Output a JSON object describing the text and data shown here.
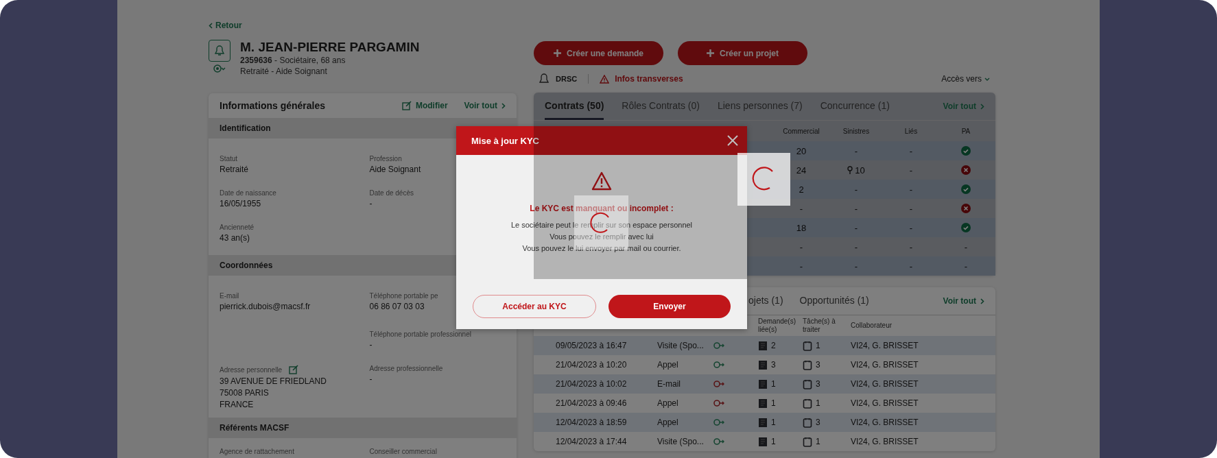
{
  "back_link": "Retour",
  "client": {
    "name": "M. JEAN-PIERRE PARGAMIN",
    "line1": "**2359636** - Sociétaire, 68 ans",
    "line2": "Retraité - Aide Soignant"
  },
  "actions": [
    "Créer une demande",
    "Créer un projet"
  ],
  "info_bar": {
    "entity": "DRSC",
    "alert": "Infos transverses",
    "access": "Accès vers"
  },
  "general_info": {
    "title": "Informations générales",
    "edit": "Modifier",
    "see_all": "Voir tout",
    "sections": [
      {
        "title": "Identification",
        "fields": [
          {
            "label": "Statut",
            "lines": [
              "Retraité"
            ]
          },
          {
            "label": "Profession",
            "lines": [
              "Aide Soignant"
            ]
          },
          {
            "label": "Date de naissance",
            "lines": [
              "16/05/1955"
            ]
          },
          {
            "label": "Date de décès",
            "lines": [
              "-"
            ]
          },
          {
            "label": "Ancienneté",
            "lines": [
              "43 an(s)"
            ]
          }
        ]
      },
      {
        "title": "Coordonnées",
        "fields": [
          {
            "label": "E-mail",
            "lines": [
              "pierrick.dubois@macsf.fr"
            ]
          },
          {
            "label": "Téléphone portable pe",
            "lines": [
              "06 86 07 03 03"
            ]
          },
          {
            "label": "Téléphone portable professionnel",
            "right_column": true,
            "lines": [
              "-"
            ]
          },
          {
            "label": "Adresse personnelle",
            "editable": true,
            "lines": [
              "39 AVENUE DE FRIEDLAND",
              "75008 PARIS",
              "FRANCE"
            ]
          },
          {
            "label": "Adresse professionnelle",
            "lines": [
              "-"
            ]
          }
        ]
      },
      {
        "title": "Référents MACSF",
        "fields": [
          {
            "label": "Agence de rattachement"
          },
          {
            "label": "Conseiller commercial"
          }
        ]
      }
    ]
  },
  "contracts": {
    "tabs": [
      {
        "label": "Contrats (50)",
        "selected": true
      },
      {
        "label": "Rôles Contrats (0)",
        "selected": false
      },
      {
        "label": "Liens personnes (7)",
        "selected": false
      },
      {
        "label": "Concurrence (1)",
        "selected": false
      }
    ],
    "see_all": "Voir tout",
    "loading": true,
    "columns": [
      "Commercial",
      "Sinistres",
      "Liés",
      "PA"
    ],
    "rows": [
      {
        "cells": [
          {
            "text": "20"
          },
          {
            "text": "-"
          },
          {
            "text": "-"
          }
        ],
        "pa": {
          "kind": "status",
          "valid": true
        }
      },
      {
        "cells": [
          {
            "text": "24"
          },
          {
            "text": "10",
            "kind": "with_icon"
          },
          {
            "text": "-"
          }
        ],
        "pa": {
          "kind": "status",
          "valid": false
        }
      },
      {
        "cells": [
          {
            "text": "2"
          },
          {
            "text": "-"
          },
          {
            "text": "-"
          }
        ],
        "pa": {
          "kind": "status",
          "valid": true
        }
      },
      {
        "cells": [
          {
            "text": "-"
          },
          {
            "text": "-"
          },
          {
            "text": "-"
          }
        ],
        "pa": {
          "kind": "status",
          "valid": false
        }
      },
      {
        "cells": [
          {
            "text": "18"
          },
          {
            "text": "-"
          },
          {
            "text": "-"
          }
        ],
        "pa": {
          "kind": "status",
          "valid": true
        }
      },
      {
        "cells": [
          {
            "text": "-"
          },
          {
            "text": "-"
          },
          {
            "text": "-"
          }
        ],
        "pa": {
          "kind": "text",
          "text": "-"
        }
      },
      {
        "cells": [
          {
            "text": "-"
          },
          {
            "text": "-"
          },
          {
            "text": "-"
          }
        ],
        "pa": {
          "kind": "text",
          "text": "-"
        }
      }
    ]
  },
  "activity": {
    "tabs": [
      {
        "label": "ojets (1)",
        "selected": false
      },
      {
        "label": "Opportunités (1)",
        "selected": false
      }
    ],
    "see_all": "Voir tout",
    "columns": [
      "Demande(s) liée(s)",
      "Tâche(s) à traiter",
      "Collaborateur"
    ],
    "rows": [
      {
        "date": "09/05/2023 à 16:47",
        "channel": "Visite (Spo...",
        "incoming": true,
        "requests": "2",
        "tasks": "1",
        "collaborator": "VI24, G. BRISSET"
      },
      {
        "date": "21/04/2023 à 10:20",
        "channel": "Appel",
        "incoming": true,
        "requests": "3",
        "tasks": "3",
        "collaborator": "VI24, G. BRISSET"
      },
      {
        "date": "21/04/2023 à 10:02",
        "channel": "E-mail",
        "incoming": false,
        "requests": "1",
        "tasks": "3",
        "collaborator": "VI24, G. BRISSET"
      },
      {
        "date": "21/04/2023 à 09:46",
        "channel": "Appel",
        "incoming": false,
        "requests": "1",
        "tasks": "1",
        "collaborator": "VI24, G. BRISSET"
      },
      {
        "date": "12/04/2023 à 18:59",
        "channel": "Appel",
        "incoming": true,
        "requests": "1",
        "tasks": "3",
        "collaborator": "VI24, G. BRISSET"
      },
      {
        "date": "12/04/2023 à 17:44",
        "channel": "Visite (Spo...",
        "incoming": true,
        "requests": "1",
        "tasks": "1",
        "collaborator": "VI24, G. BRISSET"
      }
    ]
  },
  "modal": {
    "title": "Mise à jour KYC",
    "loading": true,
    "heading": "Le KYC est manquant ou incomplet :",
    "lines": [
      "Le sociétaire peut le remplir sur son espace personnel",
      "Vous pouvez le remplir avec lui",
      "Vous pouvez le lui envoyer par mail ou courrier."
    ],
    "buttons": [
      {
        "label": "Accéder au KYC",
        "kind": "secondary"
      },
      {
        "label": "Envoyer",
        "kind": "primary"
      }
    ]
  }
}
